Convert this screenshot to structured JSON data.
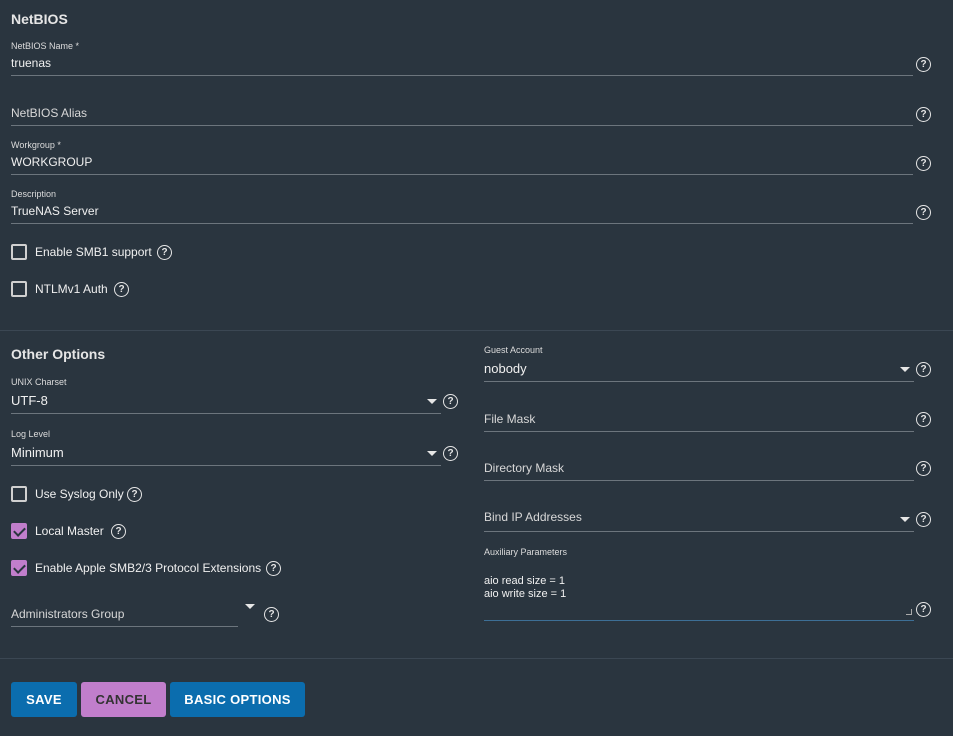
{
  "netbios": {
    "title": "NetBIOS",
    "name": {
      "label": "NetBIOS Name *",
      "value": "truenas"
    },
    "alias": {
      "placeholder": "NetBIOS Alias"
    },
    "workgroup": {
      "label": "Workgroup *",
      "value": "WORKGROUP"
    },
    "description": {
      "label": "Description",
      "value": "TrueNAS Server"
    },
    "smb1": {
      "label": "Enable SMB1 support",
      "checked": false
    },
    "ntlmv1": {
      "label": "NTLMv1 Auth",
      "checked": false
    }
  },
  "other": {
    "title": "Other Options",
    "unix_charset": {
      "label": "UNIX Charset",
      "value": "UTF-8"
    },
    "log_level": {
      "label": "Log Level",
      "value": "Minimum"
    },
    "syslog": {
      "label": "Use Syslog Only",
      "checked": false
    },
    "local_master": {
      "label": "Local Master",
      "checked": true
    },
    "apple_ext": {
      "label": "Enable Apple SMB2/3 Protocol Extensions",
      "checked": true
    },
    "admin_group": {
      "placeholder": "Administrators Group"
    },
    "guest_account": {
      "label": "Guest Account",
      "value": "nobody"
    },
    "file_mask": {
      "placeholder": "File Mask"
    },
    "dir_mask": {
      "placeholder": "Directory Mask"
    },
    "bind_ip": {
      "placeholder": "Bind IP Addresses"
    },
    "aux_params": {
      "label": "Auxiliary Parameters",
      "value": "aio read size = 1\naio write size = 1"
    }
  },
  "help_glyph": "?",
  "actions": {
    "save": "SAVE",
    "cancel": "CANCEL",
    "basic": "BASIC OPTIONS"
  },
  "colors": {
    "background": "#2a353f",
    "primary": "#0b6dae",
    "accent": "#c17ecc"
  }
}
